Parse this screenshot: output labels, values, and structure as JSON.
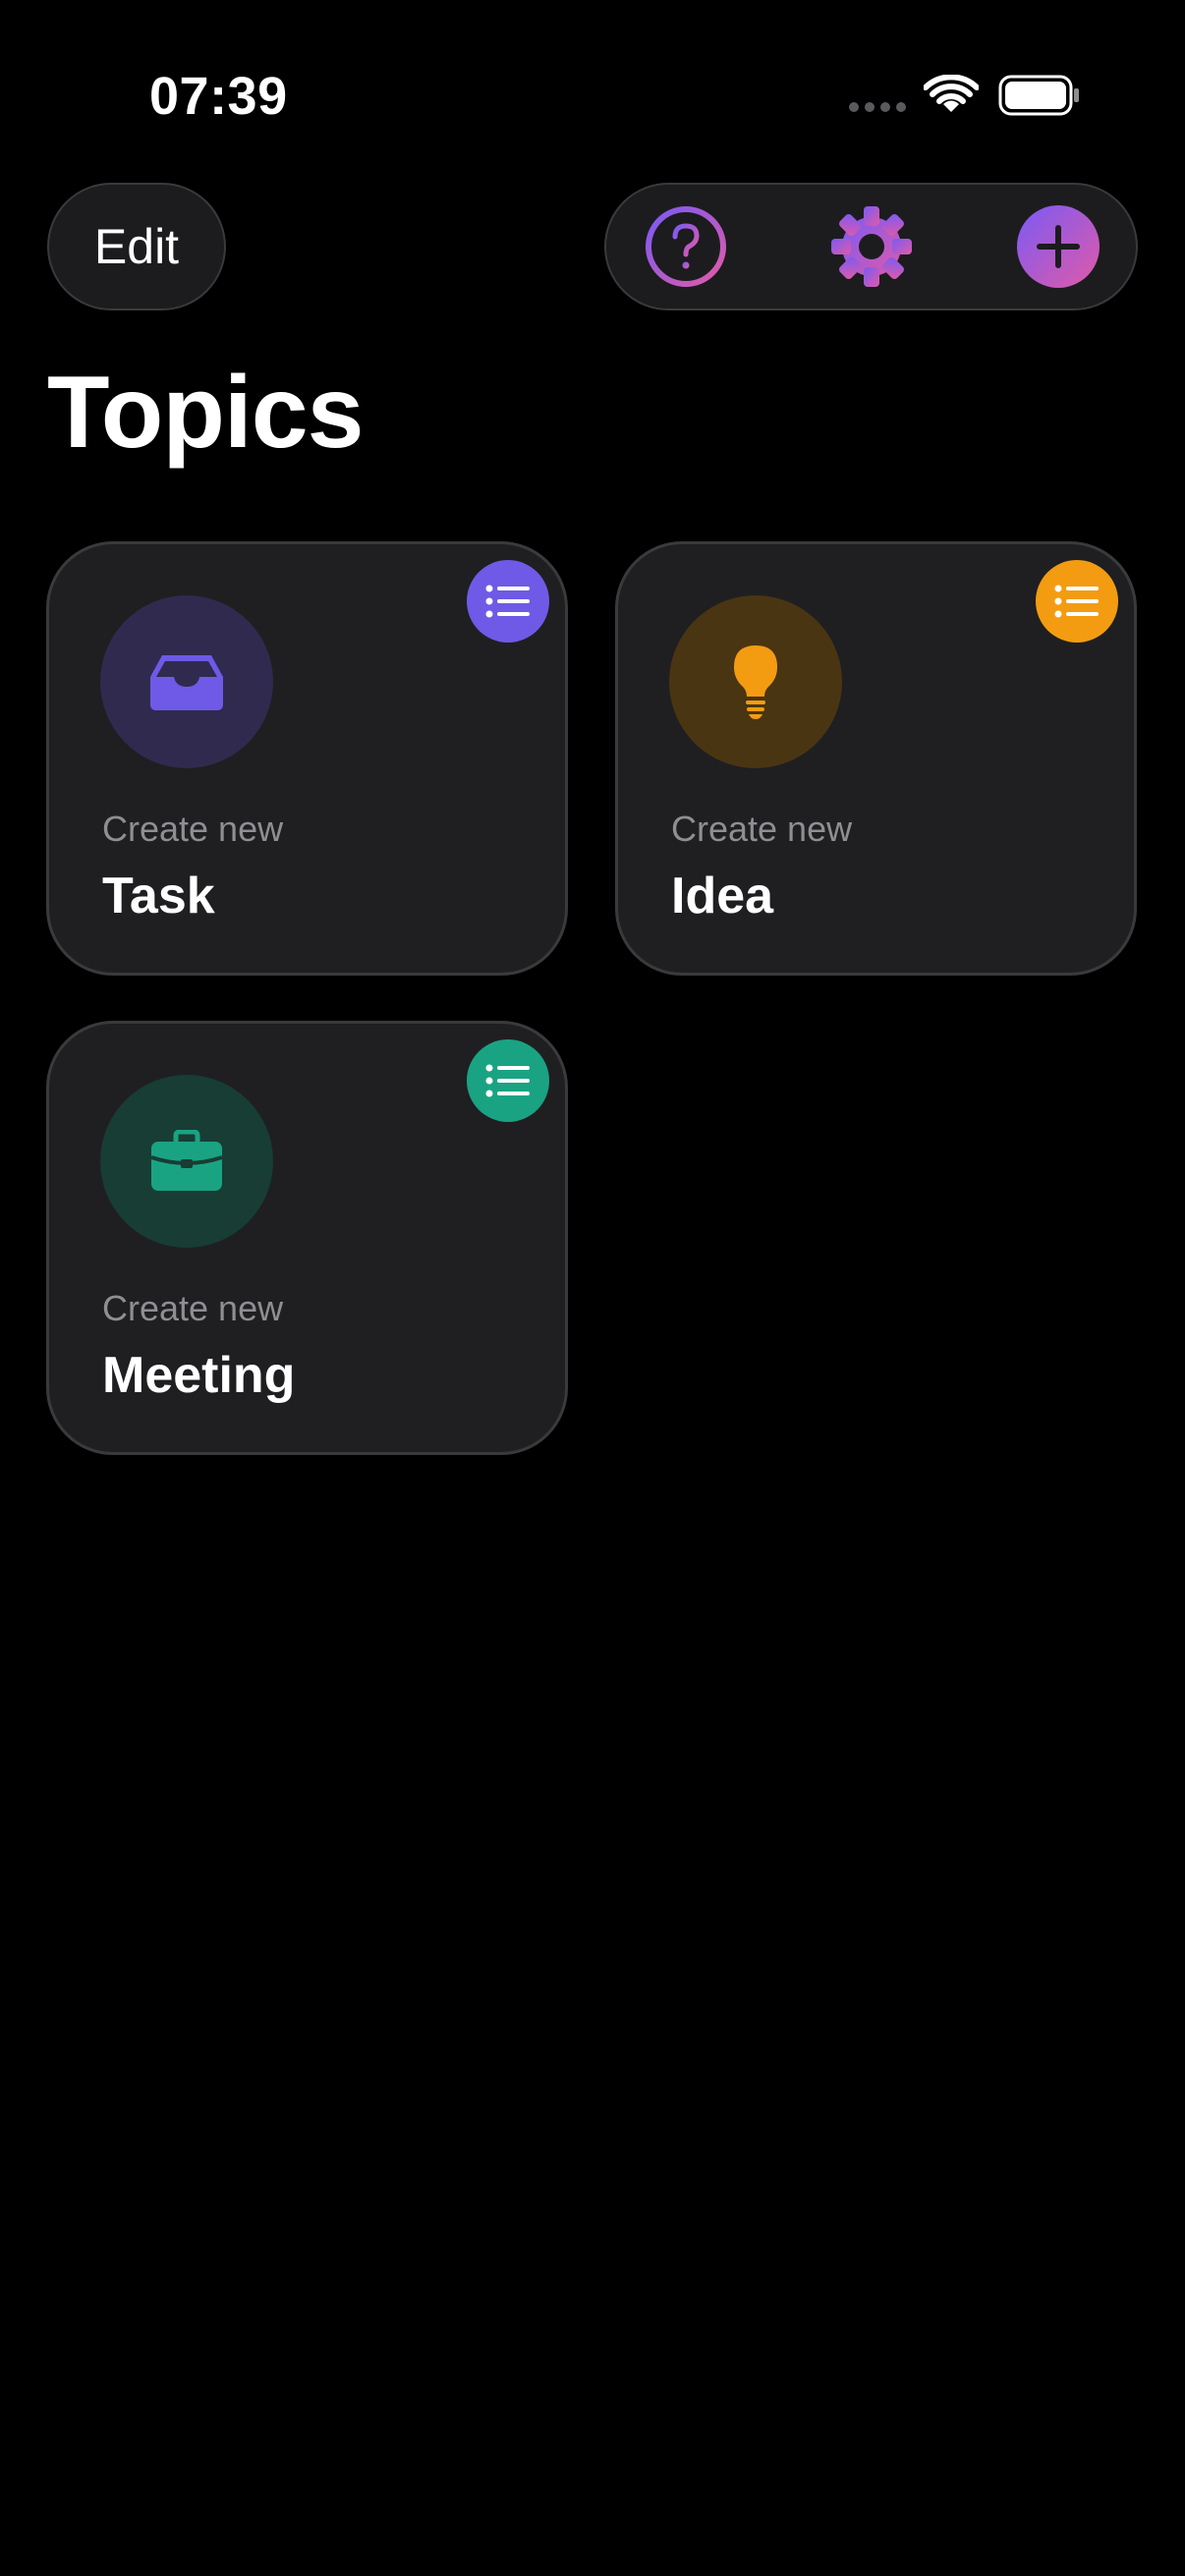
{
  "status_bar": {
    "time": "07:39",
    "icons": [
      "cellular-signal-icon",
      "wifi-icon",
      "battery-icon"
    ]
  },
  "header": {
    "edit_label": "Edit",
    "toolbar_icons": [
      "question-mark-icon",
      "gear-icon",
      "plus-icon"
    ]
  },
  "page": {
    "title": "Topics"
  },
  "topics": [
    {
      "subtitle": "Create new",
      "name": "Task",
      "icon": "inbox-tray-icon",
      "accent": "#6e5ae6"
    },
    {
      "subtitle": "Create new",
      "name": "Idea",
      "icon": "lightbulb-icon",
      "accent": "#f39c12"
    },
    {
      "subtitle": "Create new",
      "name": "Meeting",
      "icon": "briefcase-icon",
      "accent": "#1aa383"
    }
  ],
  "colors": {
    "background": "#000000",
    "card": "#1f1f21",
    "gradient_start": "#7a5af5",
    "gradient_end": "#e05aa8"
  }
}
